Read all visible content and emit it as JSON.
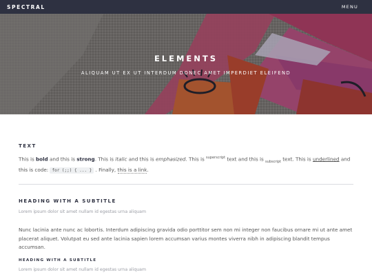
{
  "header": {
    "brand": "SPECTRAL",
    "menu": "MENU"
  },
  "banner": {
    "title": "ELEMENTS",
    "subtitle": "ALIQUAM UT EX UT INTERDUM DONEC AMET IMPERDIET ELEIFEND"
  },
  "text_section": {
    "heading": "TEXT",
    "p1": "This is ",
    "bold": "bold",
    "p2": " and this is ",
    "strong": "strong",
    "p3": ". This is ",
    "italic": "italic",
    "p4": " and this is ",
    "emphasized": "emphasized",
    "p5": ". This is ",
    "superscript": "superscript",
    "p6": " text and this is ",
    "subscript": "subscript",
    "p7": " text. This is ",
    "underlined": "underlined",
    "p8": " and this is code: ",
    "code": "for (;;) { ... }",
    "p9": " . Finally, ",
    "link": "this is a link",
    "p10": "."
  },
  "subtitle_section": {
    "heading": "HEADING WITH A SUBTITLE",
    "lead": "Lorem ipsum dolor sit amet nullam id egestas urna aliquam",
    "body": "Nunc lacinia ante nunc ac lobortis. Interdum adipiscing gravida odio porttitor sem non mi integer non faucibus ornare mi ut ante amet placerat aliquet. Volutpat eu sed ante lacinia sapien lorem accumsan varius montes viverra nibh in adipiscing blandit tempus accumsan.",
    "heading2": "HEADING WITH A SUBTITLE",
    "lead2": "Lorem ipsum dolor sit amet nullam id egestas urna aliquam"
  },
  "colors": {
    "nav_bg": "#2e3141",
    "heading": "#2e3141",
    "body_text": "#555555",
    "muted_text": "#9a9ca4"
  }
}
